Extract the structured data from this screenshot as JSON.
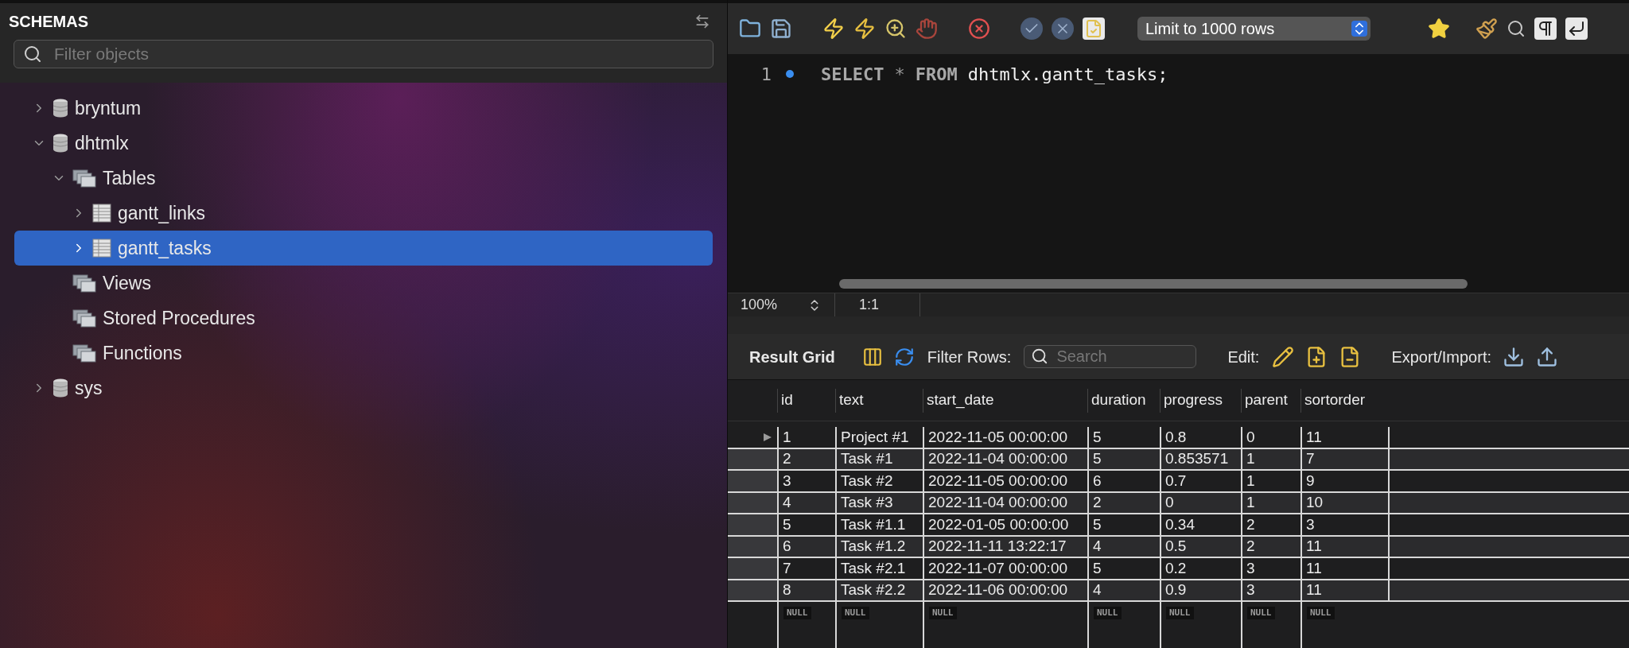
{
  "sidebar": {
    "title": "SCHEMAS",
    "filter": {
      "placeholder": "Filter objects"
    },
    "tree": [
      {
        "label": "bryntum",
        "kind": "schema",
        "expanded": false,
        "selected": false
      },
      {
        "label": "dhtmlx",
        "kind": "schema",
        "expanded": true,
        "selected": false,
        "children": [
          {
            "label": "Tables",
            "kind": "folder",
            "expanded": true,
            "selected": false,
            "children": [
              {
                "label": "gantt_links",
                "kind": "table",
                "expanded": false,
                "selected": false
              },
              {
                "label": "gantt_tasks",
                "kind": "table",
                "expanded": false,
                "selected": true
              }
            ]
          },
          {
            "label": "Views",
            "kind": "folder",
            "selected": false
          },
          {
            "label": "Stored Procedures",
            "kind": "folder",
            "selected": false
          },
          {
            "label": "Functions",
            "kind": "folder",
            "selected": false
          }
        ]
      },
      {
        "label": "sys",
        "kind": "schema",
        "expanded": false,
        "selected": false
      }
    ]
  },
  "toolbar": {
    "limit": "Limit to 1000 rows"
  },
  "editor": {
    "lines": [
      {
        "number": "1",
        "tokens": [
          {
            "text": "SELECT",
            "kind": "keyword"
          },
          {
            "text": "*",
            "kind": "operator"
          },
          {
            "text": "FROM",
            "kind": "keyword"
          },
          {
            "text": "dhtmlx.gantt_tasks;",
            "kind": "identifier"
          }
        ]
      }
    ],
    "zoom": "100%",
    "position": "1:1"
  },
  "results": {
    "title": "Result Grid",
    "filter_label": "Filter Rows:",
    "search": {
      "placeholder": "Search"
    },
    "edit_label": "Edit:",
    "export_label": "Export/Import:",
    "columns": [
      "id",
      "text",
      "start_date",
      "duration",
      "progress",
      "parent",
      "sortorder"
    ],
    "rows": [
      {
        "current": true,
        "cells": [
          "1",
          "Project #1",
          "2022-11-05 00:00:00",
          "5",
          "0.8",
          "0",
          "11"
        ]
      },
      {
        "current": false,
        "cells": [
          "2",
          "Task #1",
          "2022-11-04 00:00:00",
          "5",
          "0.853571",
          "1",
          "7"
        ]
      },
      {
        "current": false,
        "cells": [
          "3",
          "Task #2",
          "2022-11-05 00:00:00",
          "6",
          "0.7",
          "1",
          "9"
        ]
      },
      {
        "current": false,
        "cells": [
          "4",
          "Task #3",
          "2022-11-04 00:00:00",
          "2",
          "0",
          "1",
          "10"
        ]
      },
      {
        "current": false,
        "cells": [
          "5",
          "Task #1.1",
          "2022-01-05 00:00:00",
          "5",
          "0.34",
          "2",
          "3"
        ]
      },
      {
        "current": false,
        "cells": [
          "6",
          "Task #1.2",
          "2022-11-11 13:22:17",
          "4",
          "0.5",
          "2",
          "11"
        ]
      },
      {
        "current": false,
        "cells": [
          "7",
          "Task #2.1",
          "2022-11-07 00:00:00",
          "5",
          "0.2",
          "3",
          "11"
        ]
      },
      {
        "current": false,
        "cells": [
          "8",
          "Task #2.2",
          "2022-11-06 00:00:00",
          "4",
          "0.9",
          "3",
          "11"
        ]
      }
    ],
    "null_row": [
      "NULL",
      "NULL",
      "NULL",
      "NULL",
      "NULL",
      "NULL",
      "NULL"
    ]
  }
}
